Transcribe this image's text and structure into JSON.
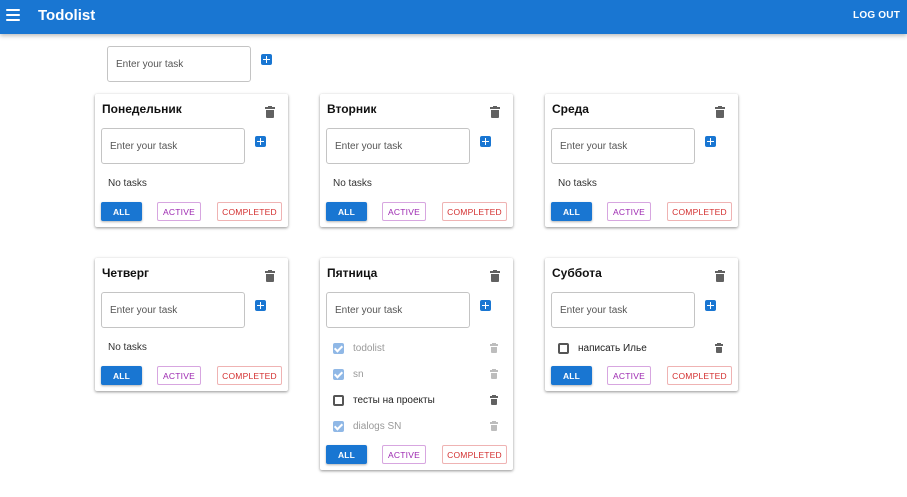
{
  "app": {
    "title": "Todolist",
    "logout_label": "LOG OUT"
  },
  "new_list": {
    "placeholder": "Enter your task"
  },
  "filters": {
    "all": "ALL",
    "active": "ACTIVE",
    "completed": "COMPLETED"
  },
  "lists": [
    {
      "title": "Понедельник",
      "placeholder": "Enter your task",
      "empty_text": "No tasks",
      "tasks": []
    },
    {
      "title": "Вторник",
      "placeholder": "Enter your task",
      "empty_text": "No tasks",
      "tasks": []
    },
    {
      "title": "Среда",
      "placeholder": "Enter your task",
      "empty_text": "No tasks",
      "tasks": []
    },
    {
      "title": "Четверг",
      "placeholder": "Enter your task",
      "empty_text": "No tasks",
      "tasks": []
    },
    {
      "title": "Пятница",
      "placeholder": "Enter your task",
      "empty_text": "",
      "tasks": [
        {
          "title": "todolist",
          "done": true
        },
        {
          "title": "sn",
          "done": true
        },
        {
          "title": "тесты на проекты",
          "done": false
        },
        {
          "title": "dialogs SN",
          "done": true
        }
      ]
    },
    {
      "title": "Суббота",
      "placeholder": "Enter your task",
      "empty_text": "",
      "tasks": [
        {
          "title": "написать Илье",
          "done": false
        }
      ]
    }
  ]
}
